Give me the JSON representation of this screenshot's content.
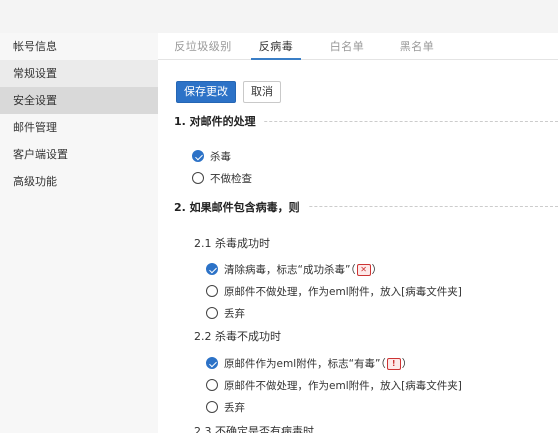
{
  "sidebar": {
    "items": [
      {
        "label": "帐号信息"
      },
      {
        "label": "常规设置"
      },
      {
        "label": "安全设置"
      },
      {
        "label": "邮件管理"
      },
      {
        "label": "客户端设置"
      },
      {
        "label": "高级功能"
      }
    ]
  },
  "tabs": [
    {
      "label": "反垃圾级别"
    },
    {
      "label": "反病毒",
      "active": true
    },
    {
      "label": "白名单"
    },
    {
      "label": "黑名单"
    }
  ],
  "toolbar": {
    "save_label": "保存更改",
    "cancel_label": "取消"
  },
  "section1": {
    "title": "1. 对邮件的处理",
    "options": [
      {
        "label": "杀毒",
        "checked": true
      },
      {
        "label": "不做检查",
        "checked": false
      }
    ]
  },
  "section2": {
    "title": "2. 如果邮件包含病毒，则",
    "sub1": {
      "title": "2.1 杀毒成功时",
      "options": [
        {
          "prefix": "清除病毒，标志“成功杀毒”（",
          "suffix": "）",
          "icon": "red-x-icon",
          "checked": true
        },
        {
          "label": "原邮件不做处理，作为eml附件，放入[病毒文件夹]",
          "checked": false
        },
        {
          "label": "丢弃",
          "checked": false
        }
      ]
    },
    "sub2": {
      "title": "2.2 杀毒不成功时",
      "options": [
        {
          "prefix": "原邮件作为eml附件，标志“有毒”（",
          "suffix": "）",
          "icon": "red-alert-icon",
          "checked": true
        },
        {
          "label": "原邮件不做处理，作为eml附件，放入[病毒文件夹]",
          "checked": false
        },
        {
          "label": "丢弃",
          "checked": false
        }
      ]
    },
    "sub3": {
      "title": "2.3 不确定是否有病毒时"
    }
  },
  "colors": {
    "accent": "#2c72c7",
    "sidebar_bg": "#f7f7f7",
    "sidebar_active": "#d9d9d9",
    "warning": "#cc3333"
  }
}
